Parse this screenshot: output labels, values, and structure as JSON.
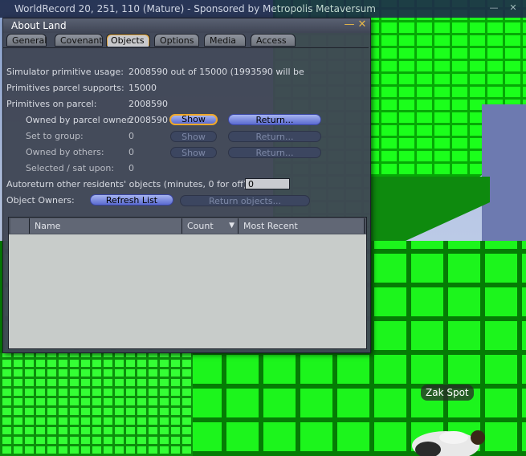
{
  "window_title": "WorldRecord 20, 251, 110 (Mature) - Sponsored by Metropolis Metaversum",
  "floater": {
    "title": "About Land",
    "tabs": [
      "General",
      "Covenant",
      "Objects",
      "Options",
      "Media",
      "Access"
    ],
    "active_tab": "Objects"
  },
  "objects": {
    "sim_usage_label": "Simulator primitive usage:",
    "sim_usage_value": "2008590 out of 15000 (1993590 will be",
    "parcel_supports_label": "Primitives parcel supports:",
    "parcel_supports_value": "15000",
    "on_parcel_label": "Primitives on parcel:",
    "on_parcel_value": "2008590",
    "rows": [
      {
        "label": "Owned by parcel owner:",
        "value": "2008590",
        "show": "Show",
        "return": "Return..."
      },
      {
        "label": "Set to group:",
        "value": "0",
        "show": "Show",
        "return": "Return..."
      },
      {
        "label": "Owned by others:",
        "value": "0",
        "show": "Show",
        "return": "Return..."
      },
      {
        "label": "Selected / sat upon:",
        "value": "0"
      }
    ],
    "autoreturn_label": "Autoreturn other residents' objects (minutes, 0 for off):",
    "autoreturn_value": "0",
    "owners_label": "Object Owners:",
    "refresh_button": "Refresh List",
    "return_objects_button": "Return objects...",
    "columns": [
      "Name",
      "Count",
      "Most Recent"
    ]
  },
  "avatar_name": "Zak Spot",
  "colors": {
    "accent_focus": "#f0a828",
    "button_enabled": "#7b8ae0",
    "ground": "#1cf51c"
  }
}
